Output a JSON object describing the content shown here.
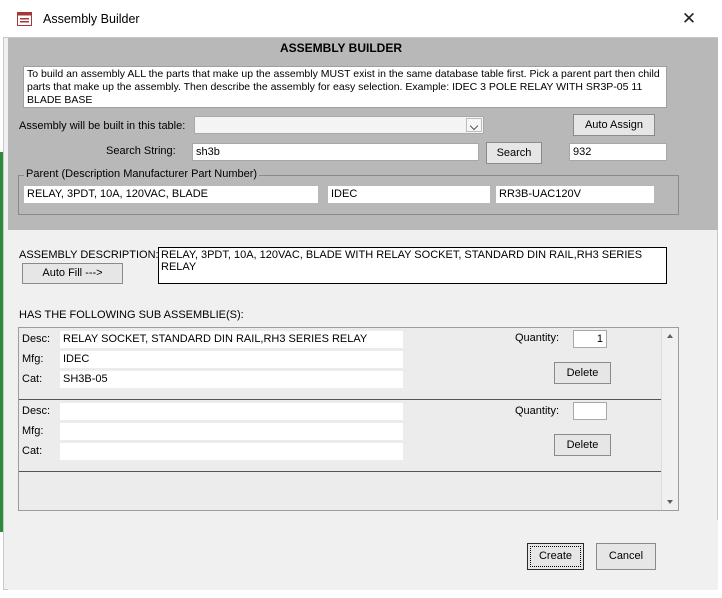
{
  "window": {
    "title": "Assembly Builder",
    "close_glyph": "✕"
  },
  "header": {
    "title": "ASSEMBLY BUILDER",
    "instructions": "To build an assembly ALL the parts that make up the assembly MUST exist in the same database table first. Pick a parent part then child parts that make up the assembly. Then describe the assembly for easy selection. Example: IDEC 3 POLE RELAY WITH SR3P-05 11 BLADE BASE"
  },
  "table_select": {
    "label": "Assembly will be built in this table:",
    "value": ""
  },
  "auto_assign_label": "Auto Assign",
  "search": {
    "label": "Search String:",
    "value": "sh3b",
    "button_label": "Search",
    "result_count": "932"
  },
  "parent": {
    "legend": "Parent (Description Manufacturer Part Number)",
    "description": "RELAY, 3PDT, 10A, 120VAC, BLADE",
    "manufacturer": "IDEC",
    "part_number": "RR3B-UAC120V"
  },
  "assembly": {
    "label": "ASSEMBLY DESCRIPTION:",
    "auto_fill_label": "Auto Fill --->",
    "description": "RELAY, 3PDT, 10A, 120VAC, BLADE WITH RELAY SOCKET, STANDARD DIN RAIL,RH3 SERIES RELAY"
  },
  "sub_assemblies": {
    "heading": "HAS THE FOLLOWING SUB ASSEMBLIE(S):",
    "desc_label": "Desc:",
    "mfg_label": "Mfg:",
    "cat_label": "Cat:",
    "quantity_label": "Quantity:",
    "delete_label": "Delete",
    "rows": [
      {
        "desc": "RELAY SOCKET, STANDARD DIN RAIL,RH3 SERIES RELAY",
        "mfg": "IDEC",
        "cat": "SH3B-05",
        "quantity": "1"
      },
      {
        "desc": "",
        "mfg": "",
        "cat": "",
        "quantity": ""
      }
    ]
  },
  "footer": {
    "create_label": "Create",
    "cancel_label": "Cancel"
  },
  "colors": {
    "header_band": "#b8b8b8",
    "dialog_bg": "#f0f0f0",
    "accent_green": "#2e8b3a"
  },
  "icons": {
    "app": "form-icon",
    "close": "close-icon"
  }
}
